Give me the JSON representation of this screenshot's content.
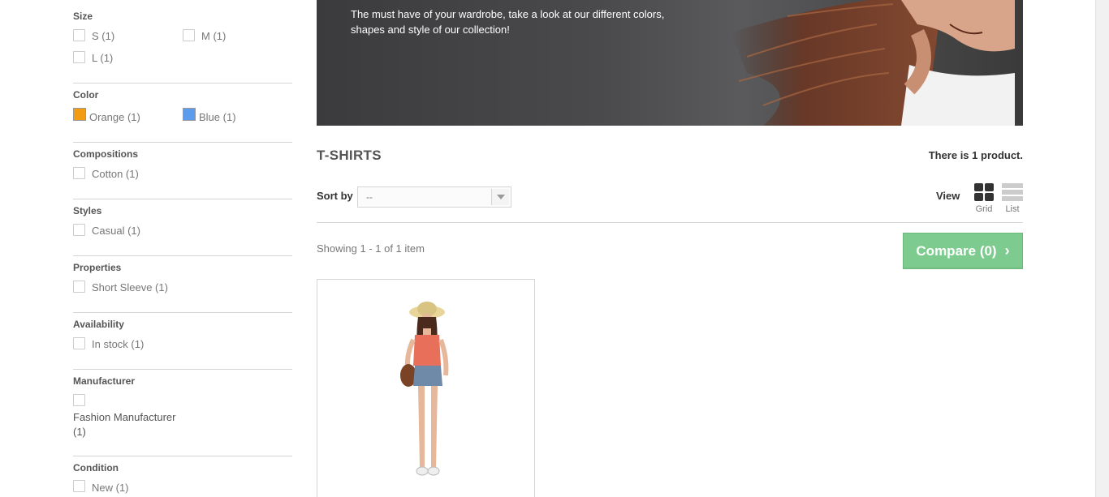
{
  "filters": {
    "size": {
      "title": "Size",
      "options": [
        "S (1)",
        "M (1)",
        "L (1)"
      ]
    },
    "color": {
      "title": "Color",
      "options": [
        {
          "label": "Orange (1)",
          "color": "#f39c11"
        },
        {
          "label": "Blue (1)",
          "color": "#5d9cec"
        }
      ]
    },
    "compositions": {
      "title": "Compositions",
      "options": [
        "Cotton (1)"
      ]
    },
    "styles": {
      "title": "Styles",
      "options": [
        "Casual (1)"
      ]
    },
    "properties": {
      "title": "Properties",
      "options": [
        "Short Sleeve (1)"
      ]
    },
    "availability": {
      "title": "Availability",
      "options": [
        "In stock (1)"
      ]
    },
    "manufacturer": {
      "title": "Manufacturer",
      "option_line1": "Fashion Manufacturer",
      "option_line2": "(1)"
    },
    "condition": {
      "title": "Condition",
      "options": [
        "New (1)"
      ]
    }
  },
  "banner": {
    "text": "The must have of your wardrobe, take a look at our different colors, shapes and style of our collection!"
  },
  "category": {
    "title": "T-SHIRTS",
    "count_prefix": "There is ",
    "count_value": "1",
    "count_suffix": " product."
  },
  "sort": {
    "label": "Sort by",
    "selected": "--"
  },
  "view": {
    "label": "View",
    "grid": "Grid",
    "list": "List"
  },
  "listing": {
    "showing": "Showing 1 - 1 of 1 item"
  },
  "compare": {
    "label": "Compare (0)"
  },
  "icons": {
    "compare_chevron": "chevron-right-icon"
  }
}
